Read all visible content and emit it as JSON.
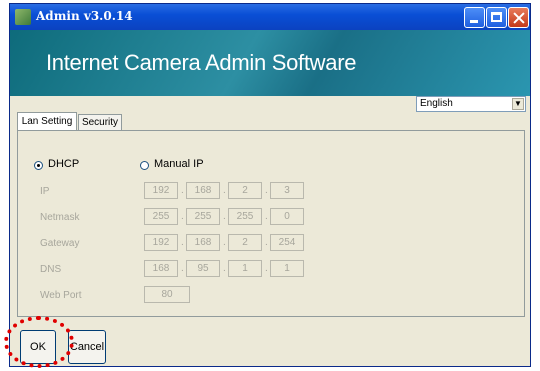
{
  "window": {
    "title": "Admin v3.0.14"
  },
  "banner": {
    "title": "Internet Camera Admin Software"
  },
  "language": {
    "selected": "English"
  },
  "tabs": [
    "Lan Setting",
    "Security"
  ],
  "network": {
    "dhcp_label": "DHCP",
    "manual_label": "Manual IP",
    "selected_mode": "DHCP",
    "fields": [
      {
        "label": "IP",
        "octets": [
          "192",
          "168",
          "2",
          "3"
        ]
      },
      {
        "label": "Netmask",
        "octets": [
          "255",
          "255",
          "255",
          "0"
        ]
      },
      {
        "label": "Gateway",
        "octets": [
          "192",
          "168",
          "2",
          "254"
        ]
      },
      {
        "label": "DNS",
        "octets": [
          "168",
          "95",
          "1",
          "1"
        ]
      }
    ],
    "web_port": {
      "label": "Web Port",
      "value": "80"
    }
  },
  "buttons": {
    "ok": "OK",
    "cancel": "Cancel"
  },
  "colors": {
    "titlebar": "#0a4fd6",
    "banner": "#1a6f86",
    "highlight": "#e00000"
  }
}
